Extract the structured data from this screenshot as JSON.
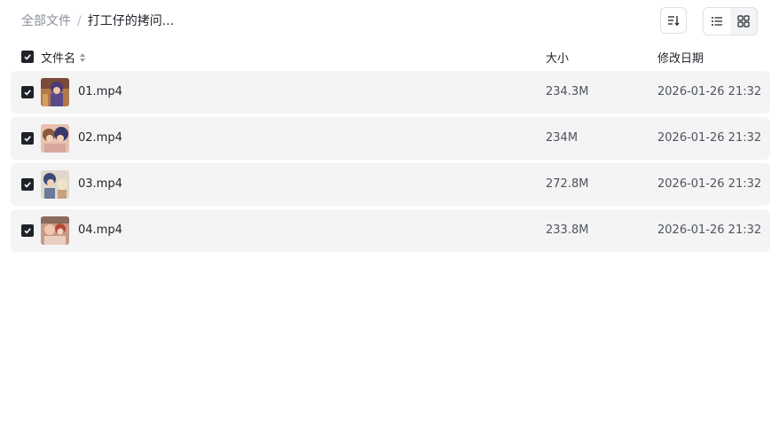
{
  "breadcrumb": {
    "root": "全部文件",
    "separator": "/",
    "current": "打工仔的拷问..."
  },
  "toolbar": {
    "sort_icon": "sort-icon",
    "view_list_icon": "list-view-icon",
    "view_grid_icon": "grid-view-icon",
    "active_view": "list"
  },
  "table": {
    "header": {
      "name": "文件名",
      "size": "大小",
      "modified": "修改日期",
      "all_selected": true
    },
    "rows": [
      {
        "name": "01.mp4",
        "size": "234.3M",
        "modified": "2026-01-26 21:32",
        "selected": true
      },
      {
        "name": "02.mp4",
        "size": "234M",
        "modified": "2026-01-26 21:32",
        "selected": true
      },
      {
        "name": "03.mp4",
        "size": "272.8M",
        "modified": "2026-01-26 21:32",
        "selected": true
      },
      {
        "name": "04.mp4",
        "size": "233.8M",
        "modified": "2026-01-26 21:32",
        "selected": true
      }
    ]
  }
}
